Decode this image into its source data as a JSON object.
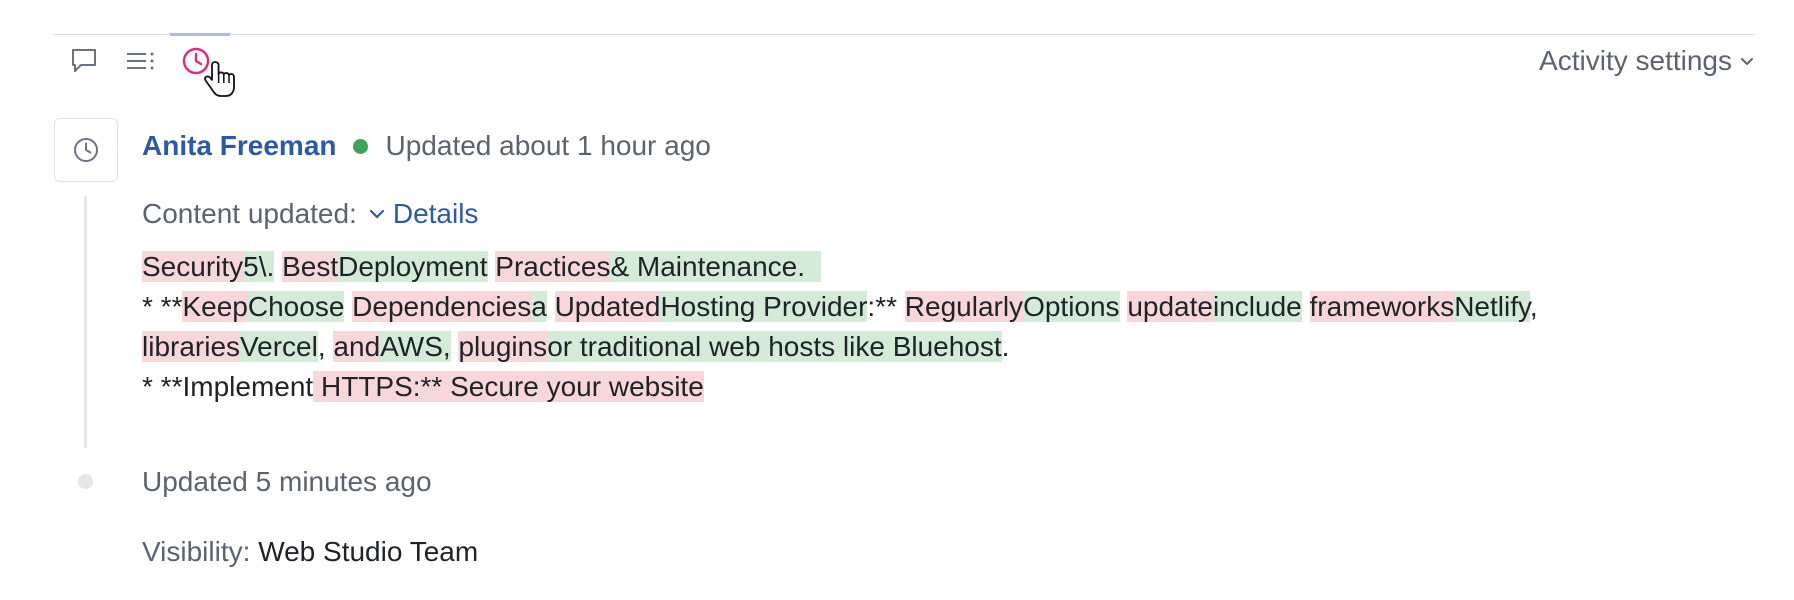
{
  "toolbar": {
    "settings_label": "Activity settings",
    "active_color": "#e0287d",
    "icons": [
      "comment-icon",
      "list-icon",
      "history-icon",
      "chevron-down-icon"
    ]
  },
  "entry": {
    "author": "Anita Freeman",
    "status_color": "#3ea45a",
    "updated": "Updated about 1 hour ago",
    "content_label": "Content updated:",
    "details_label": "Details"
  },
  "diff": {
    "lines": [
      [
        {
          "t": "Security",
          "k": "del"
        },
        {
          "t": "5\\.",
          "k": "ins"
        },
        {
          "t": " ",
          "k": ""
        },
        {
          "t": "Best",
          "k": "del"
        },
        {
          "t": "Deployment",
          "k": "ins"
        },
        {
          "t": " ",
          "k": ""
        },
        {
          "t": "Practices",
          "k": "del"
        },
        {
          "t": "& Maintenance.  ",
          "k": "ins"
        }
      ],
      [
        {
          "t": "* **",
          "k": ""
        },
        {
          "t": "Keep",
          "k": "del"
        },
        {
          "t": "Choose",
          "k": "ins"
        },
        {
          "t": " ",
          "k": ""
        },
        {
          "t": "Dependencies",
          "k": "del"
        },
        {
          "t": "a",
          "k": "ins"
        },
        {
          "t": " ",
          "k": ""
        },
        {
          "t": "Updated",
          "k": "del"
        },
        {
          "t": "Hosting Provider",
          "k": "ins"
        },
        {
          "t": ":** ",
          "k": ""
        },
        {
          "t": "Regularly",
          "k": "del"
        },
        {
          "t": "Options",
          "k": "ins"
        },
        {
          "t": " ",
          "k": ""
        },
        {
          "t": "update",
          "k": "del"
        },
        {
          "t": "include",
          "k": "ins"
        },
        {
          "t": " ",
          "k": ""
        },
        {
          "t": "frameworks",
          "k": "del"
        },
        {
          "t": "Netlify",
          "k": "ins"
        },
        {
          "t": ",",
          "k": ""
        }
      ],
      [
        {
          "t": "libraries",
          "k": "del"
        },
        {
          "t": "Vercel",
          "k": "ins"
        },
        {
          "t": ", ",
          "k": ""
        },
        {
          "t": "and",
          "k": "del"
        },
        {
          "t": "AWS,",
          "k": "ins"
        },
        {
          "t": " ",
          "k": ""
        },
        {
          "t": "plugins",
          "k": "del"
        },
        {
          "t": "or traditional web hosts like Bluehost",
          "k": "ins"
        },
        {
          "t": ".",
          "k": ""
        }
      ],
      [
        {
          "t": "* **Implement",
          "k": ""
        },
        {
          "t": " HTTPS:** Secure your website",
          "k": "del"
        }
      ]
    ]
  },
  "update2": {
    "updated": "Updated 5 minutes ago",
    "visibility_label": "Visibility:",
    "visibility_value": "Web Studio Team"
  }
}
